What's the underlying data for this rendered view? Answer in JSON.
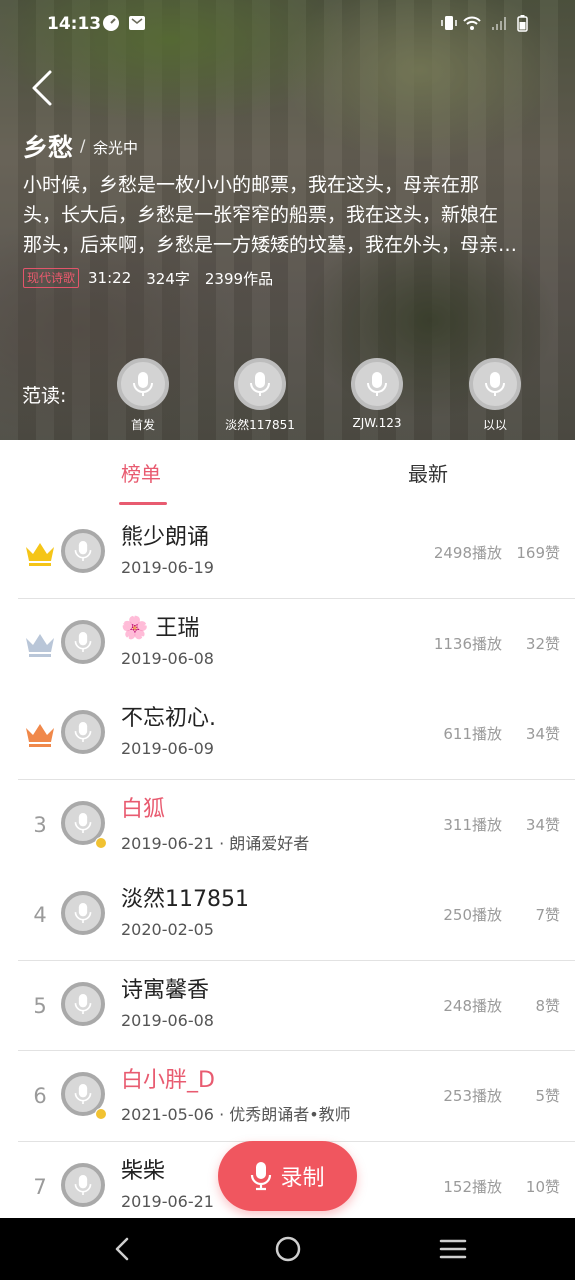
{
  "status_bar": {
    "time": "14:13"
  },
  "poem": {
    "title": "乡愁",
    "separator": "/",
    "author": "余光中",
    "excerpt_lines": [
      "小时候，乡愁是一枚小小的邮票，我在这头，母亲在那",
      "头，长大后，乡愁是一张窄窄的船票，我在这头，新娘在",
      "那头，后来啊，乡愁是一方矮矮的坟墓，我在外头，母亲…"
    ],
    "tag": "现代诗歌",
    "duration": "31:22",
    "word_count": "324字",
    "works_count": "2399作品"
  },
  "readers": {
    "label": "范读:",
    "items": [
      {
        "name": "首发"
      },
      {
        "name": "淡然117851"
      },
      {
        "name": "ZJW.123"
      },
      {
        "name": "以以"
      }
    ]
  },
  "tabs": {
    "ranking": "榜单",
    "latest": "最新"
  },
  "ranking_list": [
    {
      "rank": "1",
      "crown": "gold",
      "name": "熊少朗诵",
      "date": "2019-06-19",
      "plays": "2498播放",
      "likes": "169赞",
      "verified": false,
      "highlight": false
    },
    {
      "rank": "2",
      "crown": "silver",
      "name": "🌸 王瑞",
      "date": "2019-06-08",
      "plays": "1136播放",
      "likes": "32赞",
      "verified": false,
      "highlight": false
    },
    {
      "rank": "3",
      "crown": "bronze",
      "name": "不忘初心.",
      "date": "2019-06-09",
      "plays": "611播放",
      "likes": "34赞",
      "verified": false,
      "highlight": false
    },
    {
      "rank": "3",
      "crown": "",
      "name": "白狐",
      "date": "2019-06-21 · 朗诵爱好者",
      "plays": "311播放",
      "likes": "34赞",
      "verified": true,
      "highlight": true
    },
    {
      "rank": "4",
      "crown": "",
      "name": "淡然117851",
      "date": "2020-02-05",
      "plays": "250播放",
      "likes": "7赞",
      "verified": false,
      "highlight": false
    },
    {
      "rank": "5",
      "crown": "",
      "name": "诗寓馨香",
      "date": "2019-06-08",
      "plays": "248播放",
      "likes": "8赞",
      "verified": false,
      "highlight": false
    },
    {
      "rank": "6",
      "crown": "",
      "name": "白小胖_D",
      "date": "2021-05-06 · 优秀朗诵者•教师",
      "plays": "253播放",
      "likes": "5赞",
      "verified": true,
      "highlight": true
    },
    {
      "rank": "7",
      "crown": "",
      "name": "柴柴",
      "date": "2019-06-21",
      "plays": "152播放",
      "likes": "10赞",
      "verified": false,
      "highlight": false
    }
  ],
  "record_button": {
    "label": "录制"
  },
  "colors": {
    "accent": "#e85b70",
    "record": "#f0565f",
    "gold": "#f5c518",
    "silver": "#b9c6d8",
    "bronze": "#f0884a"
  },
  "icons": [
    "back-arrow-icon",
    "mic-icon",
    "crown-icon",
    "nav-back-icon",
    "nav-home-icon",
    "nav-menu-icon"
  ]
}
